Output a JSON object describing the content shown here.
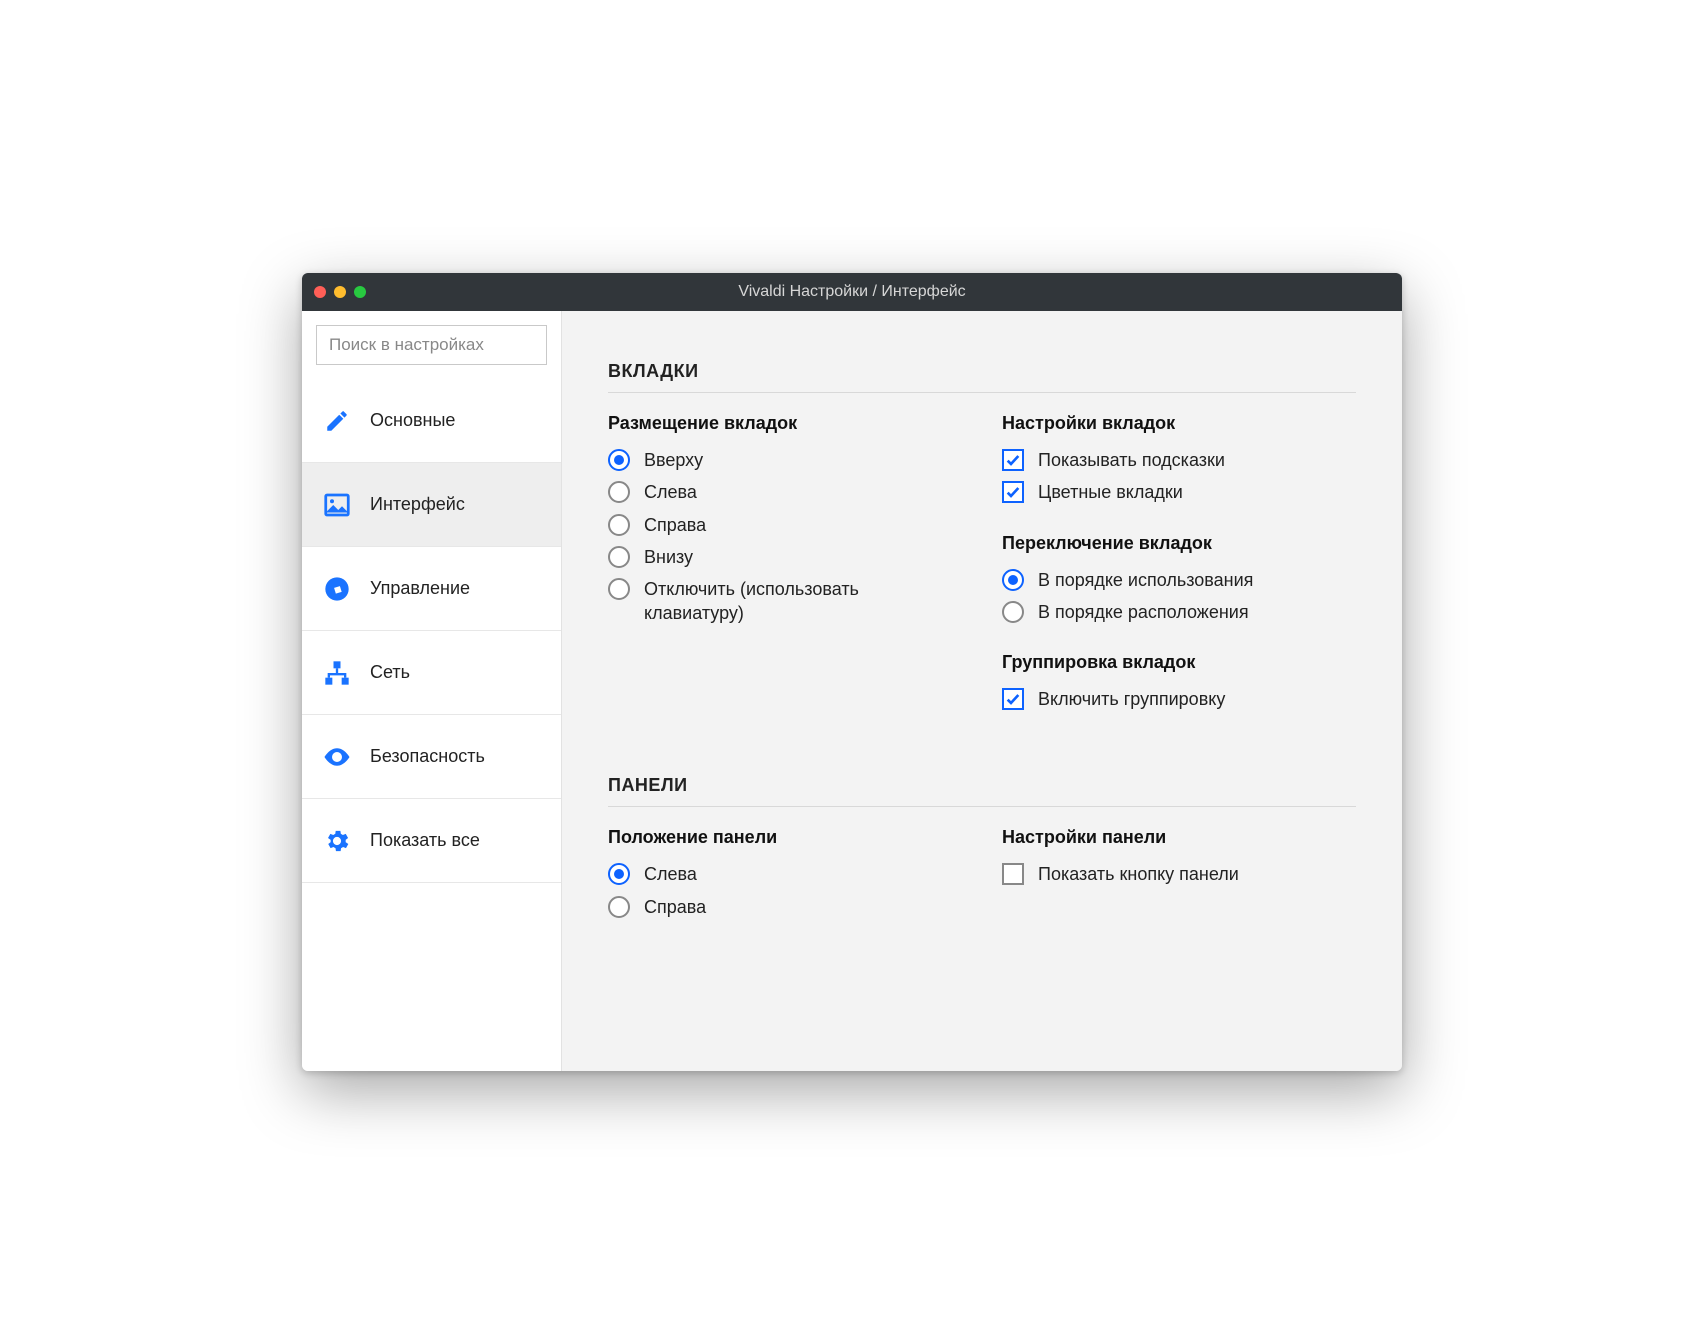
{
  "window": {
    "title": "Vivaldi Настройки / Интерфейс"
  },
  "sidebar": {
    "search_placeholder": "Поиск в настройках",
    "items": [
      {
        "label": "Основные",
        "icon": "pencil-icon",
        "active": false
      },
      {
        "label": "Интерфейс",
        "icon": "image-icon",
        "active": true
      },
      {
        "label": "Управление",
        "icon": "compass-icon",
        "active": false
      },
      {
        "label": "Сеть",
        "icon": "network-icon",
        "active": false
      },
      {
        "label": "Безопасность",
        "icon": "eye-icon",
        "active": false
      },
      {
        "label": "Показать все",
        "icon": "gear-icon",
        "active": false
      }
    ]
  },
  "sections": {
    "tabs": {
      "title": "ВКЛАДКИ",
      "placement": {
        "heading": "Размещение вкладок",
        "options": [
          {
            "label": "Вверху",
            "checked": true
          },
          {
            "label": "Слева",
            "checked": false
          },
          {
            "label": "Справа",
            "checked": false
          },
          {
            "label": "Внизу",
            "checked": false
          },
          {
            "label": "Отключить (использовать клавиатуру)",
            "checked": false
          }
        ]
      },
      "settings": {
        "heading": "Настройки вкладок",
        "options": [
          {
            "label": "Показывать подсказки",
            "checked": true
          },
          {
            "label": "Цветные вкладки",
            "checked": true
          }
        ]
      },
      "switching": {
        "heading": "Переключение вкладок",
        "options": [
          {
            "label": "В порядке использования",
            "checked": true
          },
          {
            "label": "В порядке расположения",
            "checked": false
          }
        ]
      },
      "grouping": {
        "heading": "Группировка вкладок",
        "options": [
          {
            "label": "Включить группировку",
            "checked": true
          }
        ]
      }
    },
    "panels": {
      "title": "ПАНЕЛИ",
      "position": {
        "heading": "Положение панели",
        "options": [
          {
            "label": "Слева",
            "checked": true
          },
          {
            "label": "Справа",
            "checked": false
          }
        ]
      },
      "settings": {
        "heading": "Настройки панели",
        "options": [
          {
            "label": "Показать кнопку панели",
            "checked": false
          }
        ]
      }
    }
  }
}
